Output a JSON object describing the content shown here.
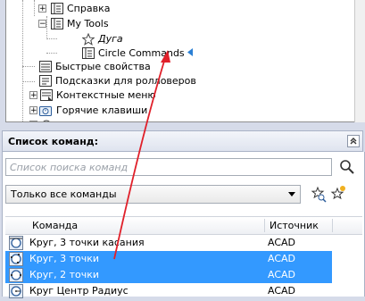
{
  "tree": {
    "items": [
      {
        "label": "Справка"
      },
      {
        "label": "My Tools"
      },
      {
        "label": "Дуга"
      },
      {
        "label": "Circle Commands"
      },
      {
        "label": "Быстрые свойства"
      },
      {
        "label": "Подсказки для ролловеров"
      },
      {
        "label": "Контекстные меню"
      },
      {
        "label": "Горячие клавиши"
      }
    ]
  },
  "command_list": {
    "title": "Список команд:",
    "search_placeholder": "Список поиска команд",
    "filter_value": "Только все команды",
    "columns": {
      "command": "Команда",
      "source": "Источник"
    },
    "rows": [
      {
        "name": "Круг, 3 точки касания",
        "source": "ACAD",
        "selected": false
      },
      {
        "name": "Круг, 3 точки",
        "source": "ACAD",
        "selected": true
      },
      {
        "name": "Круг, 2 точки",
        "source": "ACAD",
        "selected": true
      },
      {
        "name": "Круг Центр Радиус",
        "source": "ACAD",
        "selected": false
      }
    ]
  },
  "colors": {
    "selection": "#3399ff",
    "arrow": "#e0202a"
  }
}
